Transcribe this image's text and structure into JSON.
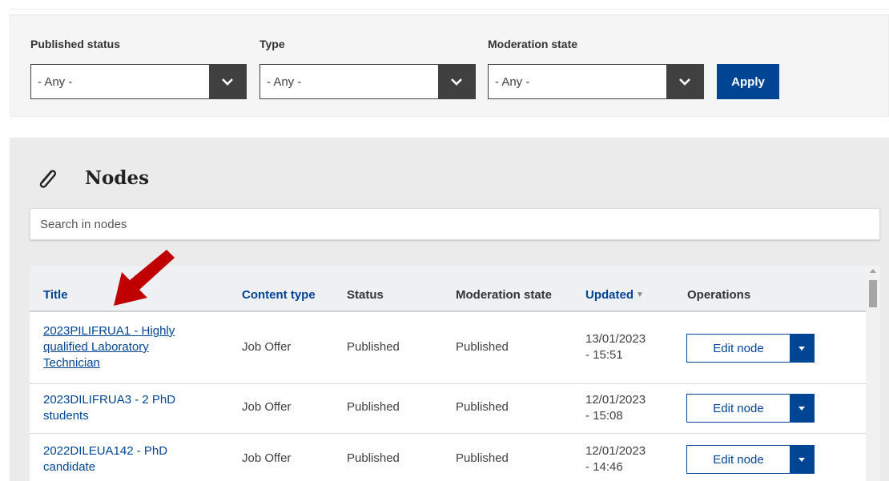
{
  "filters": {
    "published_status": {
      "label": "Published status",
      "value": "- Any -"
    },
    "type": {
      "label": "Type",
      "value": "- Any -"
    },
    "moderation_state": {
      "label": "Moderation state",
      "value": "- Any -"
    },
    "apply_label": "Apply"
  },
  "nodes": {
    "title": "Nodes",
    "search_placeholder": "Search in nodes",
    "columns": {
      "title": "Title",
      "content_type": "Content type",
      "status": "Status",
      "moderation_state": "Moderation state",
      "updated": "Updated",
      "operations": "Operations"
    },
    "rows": [
      {
        "title_lines": [
          "2023PILIFRUA1 - Highly",
          "qualified Laboratory",
          "Technician"
        ],
        "content_type": "Job Offer",
        "status": "Published",
        "moderation_state": "Published",
        "updated_lines": [
          "13/01/2023",
          "- 15:51"
        ],
        "operation": "Edit node"
      },
      {
        "title_lines": [
          "2023DILIFRUA3 - 2 PhD",
          "students"
        ],
        "content_type": "Job Offer",
        "status": "Published",
        "moderation_state": "Published",
        "updated_lines": [
          "12/01/2023",
          "- 15:08"
        ],
        "operation": "Edit node"
      },
      {
        "title_lines": [
          "2022DILEUA142 - PhD",
          "candidate"
        ],
        "content_type": "Job Offer",
        "status": "Published",
        "moderation_state": "Published",
        "updated_lines": [
          "12/01/2023",
          "- 14:46"
        ],
        "operation": "Edit node"
      }
    ]
  },
  "colors": {
    "primary": "#004494",
    "dark": "#404040",
    "annotation_arrow": "#c00000"
  },
  "icons": [
    "chevron-down-icon",
    "paperclip-icon",
    "sort-down-icon",
    "dropdown-caret-icon",
    "red-arrow-annotation"
  ]
}
